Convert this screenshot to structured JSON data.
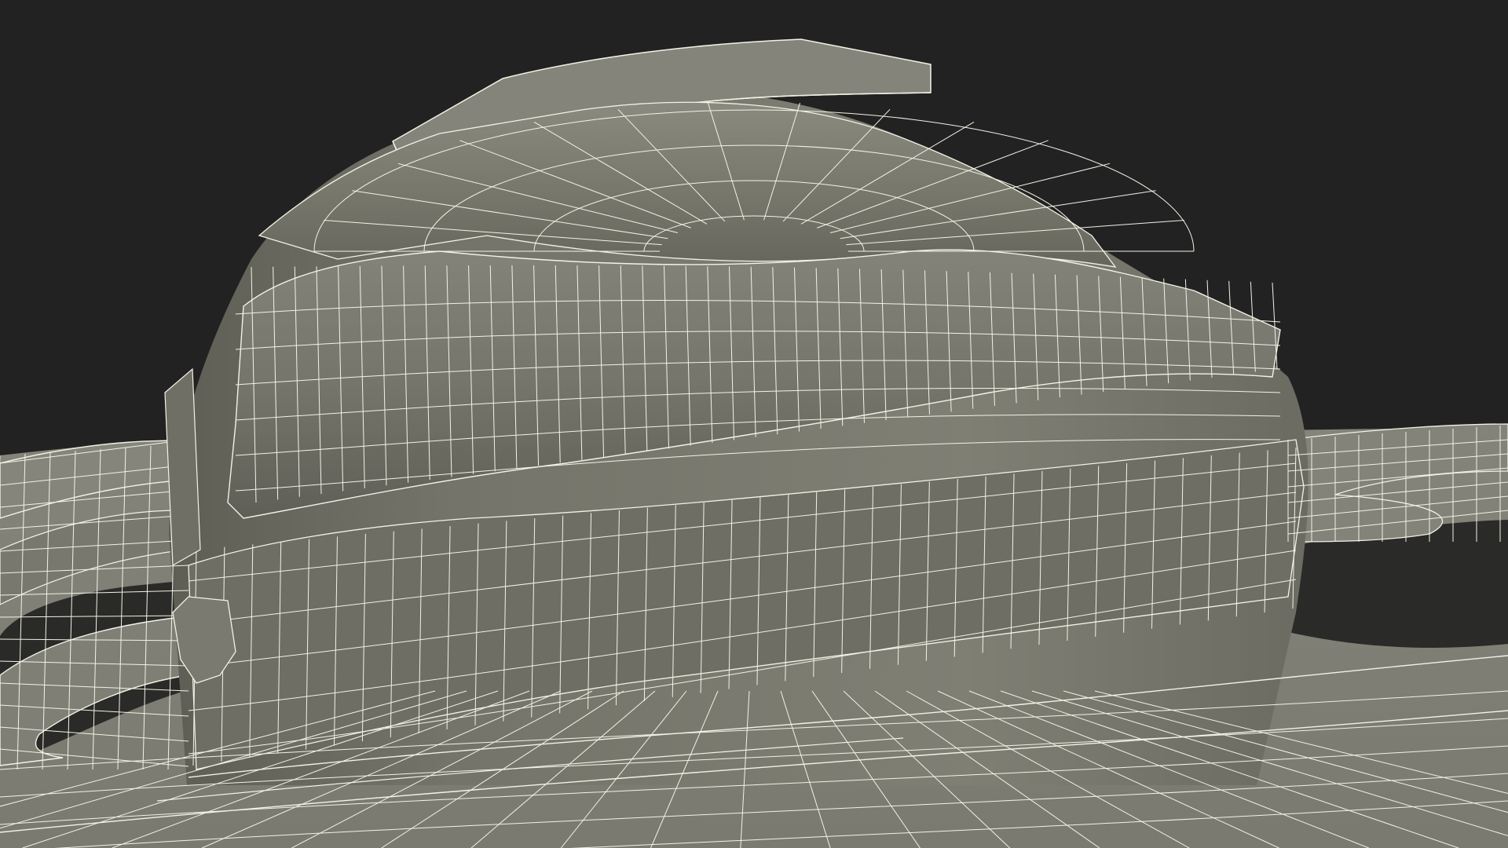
{
  "scene": {
    "subject": "wireframe-helmet-model",
    "colors": {
      "background": "#222222",
      "surface": "#7b7b70",
      "surface_light": "#8d8d82",
      "surface_dark": "#5f5f56",
      "surface_shadow": "#4e4e47",
      "wire": "#f2f2e6"
    }
  }
}
